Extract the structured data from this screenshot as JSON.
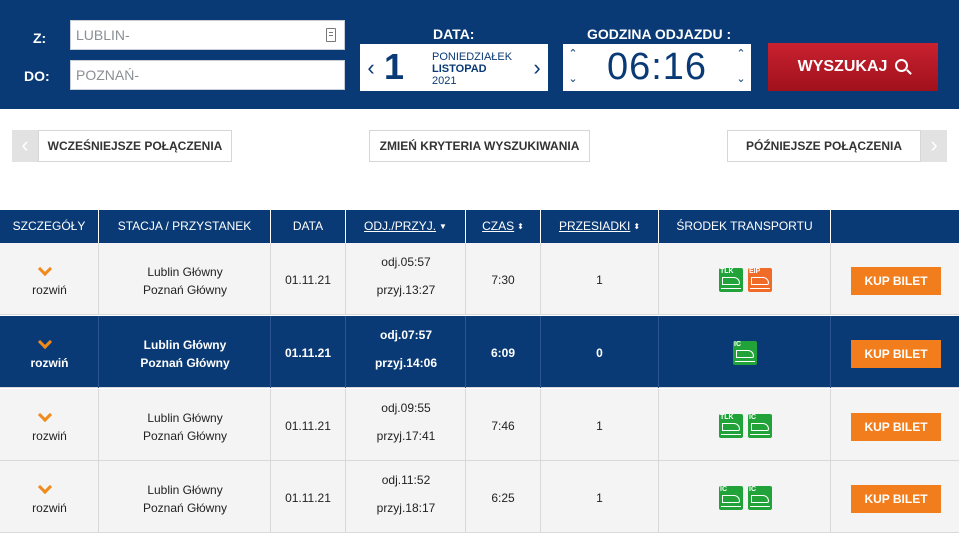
{
  "search": {
    "from_label": "Z:",
    "to_label": "DO:",
    "from_value": "LUBLIN-",
    "to_value": "POZNAŃ-",
    "date_label": "DATA:",
    "date": {
      "day": "1",
      "weekday": "PONIEDZIAŁEK",
      "month": "LISTOPAD",
      "year": "2021"
    },
    "time_label": "GODZINA ODJAZDU :",
    "time": "06:16",
    "search_button": "WYSZUKAJ"
  },
  "nav": {
    "earlier": "WCZEŚNIEJSZE POŁĄCZENIA",
    "change": "ZMIEŃ KRYTERIA WYSZUKIWANIA",
    "later": "PÓŹNIEJSZE POŁĄCZENIA"
  },
  "table": {
    "headers": [
      "SZCZEGÓŁY",
      "STACJA / PRZYSTANEK",
      "DATA",
      "ODJ./PRZYJ.",
      "CZAS",
      "PRZESIADKI",
      "ŚRODEK TRANSPORTU"
    ],
    "rows": [
      {
        "details": "rozwiń",
        "from": "Lublin Główny",
        "to": "Poznań Główny",
        "date": "01.11.21",
        "dep": "odj.05:57",
        "arr": "przyj.13:27",
        "duration": "7:30",
        "changes": "1",
        "transport": [
          "TLK",
          "EIP"
        ],
        "buy": "KUP BILET"
      },
      {
        "details": "rozwiń",
        "from": "Lublin Główny",
        "to": "Poznań Główny",
        "date": "01.11.21",
        "dep": "odj.07:57",
        "arr": "przyj.14:06",
        "duration": "6:09",
        "changes": "0",
        "transport": [
          "IC"
        ],
        "buy": "KUP BILET"
      },
      {
        "details": "rozwiń",
        "from": "Lublin Główny",
        "to": "Poznań Główny",
        "date": "01.11.21",
        "dep": "odj.09:55",
        "arr": "przyj.17:41",
        "duration": "7:46",
        "changes": "1",
        "transport": [
          "TLK",
          "IC"
        ],
        "buy": "KUP BILET"
      },
      {
        "details": "rozwiń",
        "from": "Lublin Główny",
        "to": "Poznań Główny",
        "date": "01.11.21",
        "dep": "odj.11:52",
        "arr": "przyj.18:17",
        "duration": "6:25",
        "changes": "1",
        "transport": [
          "IC",
          "IC"
        ],
        "buy": "KUP BILET"
      }
    ]
  },
  "colors": {
    "navy": "#0a3a75",
    "red": "#c9212f",
    "orange": "#f27d1d",
    "green": "#21a33a",
    "eip_orange": "#f06a28"
  }
}
